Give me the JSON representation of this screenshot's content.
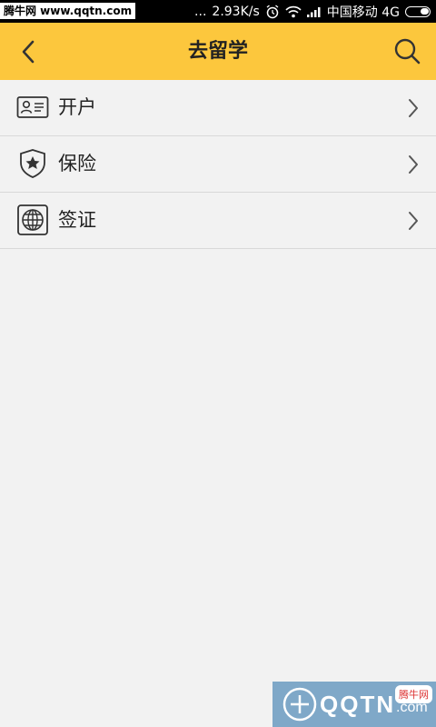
{
  "statusbar": {
    "watermark": "腾牛网 www.qqtn.com",
    "dots": "...",
    "speed": "2.93K/s",
    "carrier": "中国移动 4G"
  },
  "header": {
    "title": "去留学",
    "background": "#fcc73d"
  },
  "list": {
    "items": [
      {
        "label": "开户",
        "icon": "id-card-icon"
      },
      {
        "label": "保险",
        "icon": "shield-star-icon"
      },
      {
        "label": "签证",
        "icon": "globe-icon"
      }
    ]
  },
  "watermark_bottom": {
    "brand": "QQTN",
    "suffix": ".com",
    "badge": "腾牛网"
  }
}
